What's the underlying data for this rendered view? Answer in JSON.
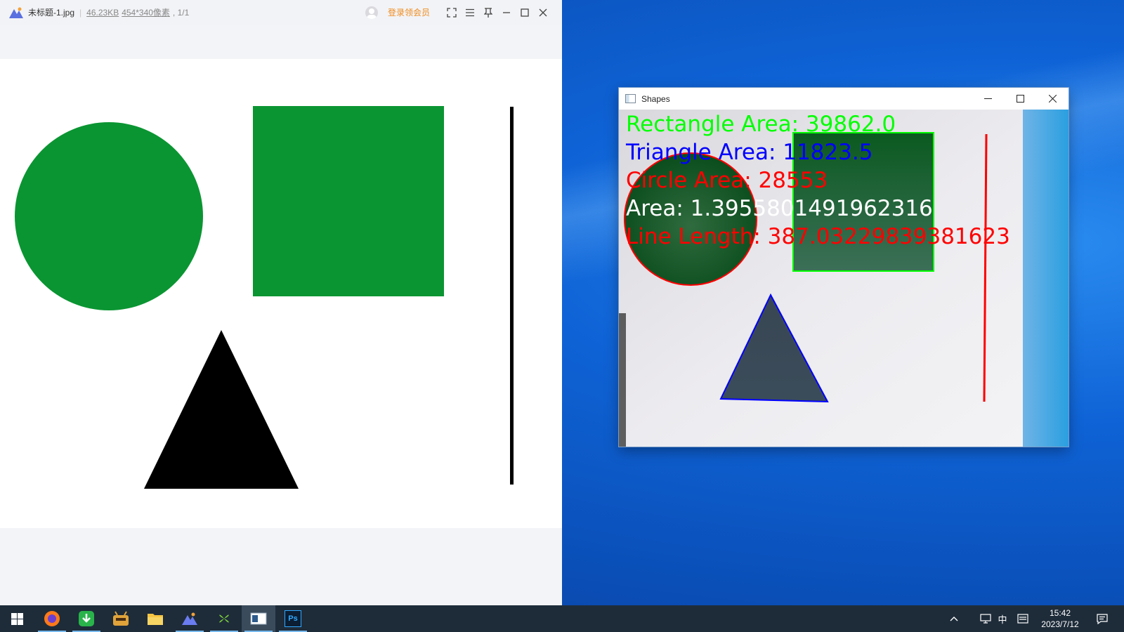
{
  "viewer": {
    "filename": "未标题-1.jpg",
    "filesize": "46.23KB",
    "dimensions": "454*340像素",
    "pages": "1/1",
    "vip_label": "登录领会员",
    "icons": [
      "fullscreen-icon",
      "menu-icon",
      "pin-icon",
      "minimize-icon",
      "maximize-icon",
      "close-icon"
    ]
  },
  "shapes_window": {
    "title": "Shapes",
    "overlay_text": {
      "rectangle": "Rectangle Area: 39862.0",
      "triangle": "Triangle Area: 11823.5",
      "circle": "Circle Area: 28553",
      "area": "Area: 1.3955801491962316",
      "line": "Line Length: 387.03229839381623"
    },
    "colors": {
      "rectangle": "#00ff00",
      "triangle": "#0000ff",
      "circle": "#ff0000",
      "area": "#ffffff",
      "line": "#ff0000"
    }
  },
  "taskbar": {
    "apps": [
      "start-icon",
      "firefox-icon",
      "download-icon",
      "game-icon",
      "file-explorer-icon",
      "image-viewer-icon",
      "plant-app-icon",
      "shapes-window-icon",
      "photoshop-icon"
    ],
    "photoshop_label": "Ps",
    "ime_label": "中",
    "time": "15:42",
    "date": "2023/7/12"
  },
  "colors": {
    "shape_green": "#0a9532",
    "taskbar_bg": "#1e2c3a",
    "vip_orange": "#f08c1e"
  }
}
